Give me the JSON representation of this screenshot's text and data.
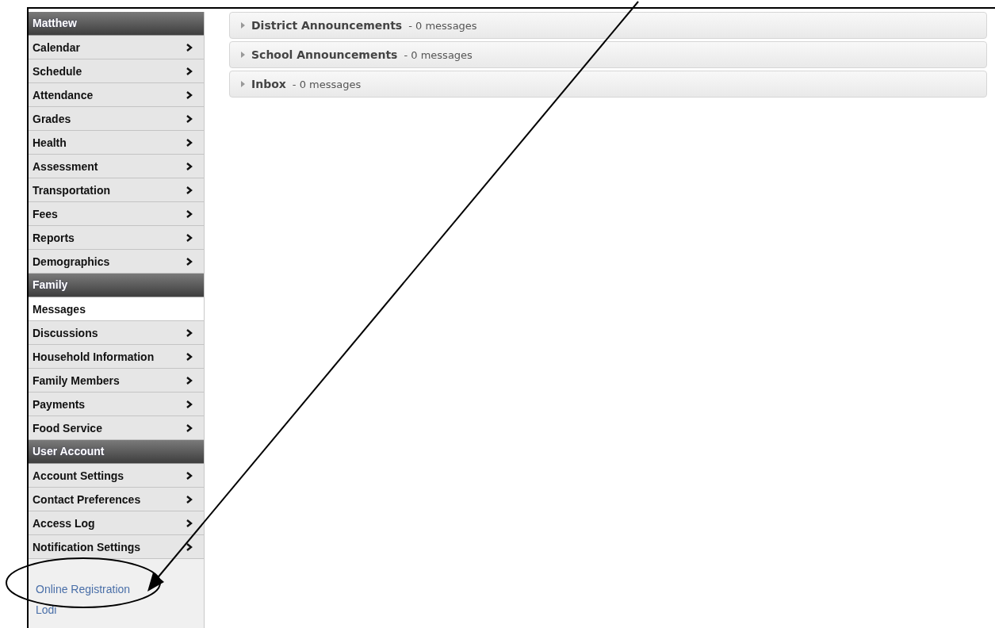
{
  "sidebar": {
    "sections": [
      {
        "title": "Matthew",
        "items": [
          {
            "label": "Calendar",
            "selected": false
          },
          {
            "label": "Schedule",
            "selected": false
          },
          {
            "label": "Attendance",
            "selected": false
          },
          {
            "label": "Grades",
            "selected": false
          },
          {
            "label": "Health",
            "selected": false
          },
          {
            "label": "Assessment",
            "selected": false
          },
          {
            "label": "Transportation",
            "selected": false
          },
          {
            "label": "Fees",
            "selected": false
          },
          {
            "label": "Reports",
            "selected": false
          },
          {
            "label": "Demographics",
            "selected": false
          }
        ]
      },
      {
        "title": "Family",
        "items": [
          {
            "label": "Messages",
            "selected": true
          },
          {
            "label": "Discussions",
            "selected": false
          },
          {
            "label": "Household Information",
            "selected": false
          },
          {
            "label": "Family Members",
            "selected": false
          },
          {
            "label": "Payments",
            "selected": false
          },
          {
            "label": "Food Service",
            "selected": false
          }
        ]
      },
      {
        "title": "User Account",
        "items": [
          {
            "label": "Account Settings",
            "selected": false
          },
          {
            "label": "Contact Preferences",
            "selected": false
          },
          {
            "label": "Access Log",
            "selected": false
          },
          {
            "label": "Notification Settings",
            "selected": false
          }
        ]
      }
    ],
    "links": [
      "Online Registration",
      "Lodi"
    ]
  },
  "message_groups": [
    {
      "title": "District Announcements",
      "count": "- 0 messages",
      "expanded": false
    },
    {
      "title": "School Announcements",
      "count": "- 0 messages",
      "expanded": false
    },
    {
      "title": "Inbox",
      "count": "- 0 messages",
      "expanded": false
    }
  ]
}
